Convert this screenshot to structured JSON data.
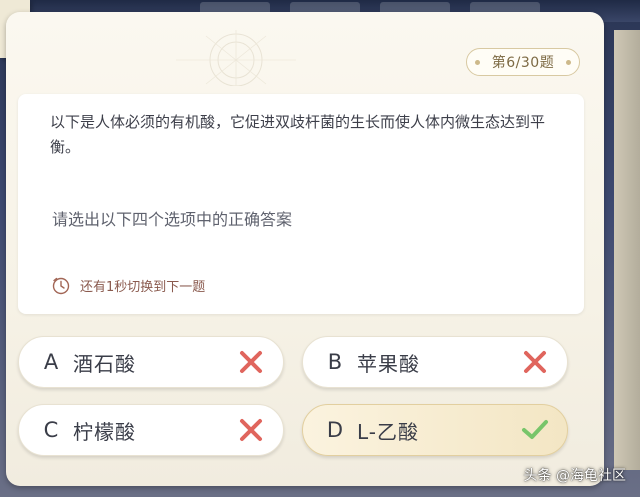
{
  "quiz": {
    "counter": "第6/30题",
    "question": "以下是人体必须的有机酸，它促进双歧杆菌的生长而使人体内微生态达到平衡。",
    "instruction": "请选出以下四个选项中的正确答案",
    "timer_text": "还有1秒切换到下一题",
    "options": [
      {
        "letter": "A",
        "text": "酒石酸",
        "status": "wrong"
      },
      {
        "letter": "B",
        "text": "苹果酸",
        "status": "wrong"
      },
      {
        "letter": "C",
        "text": "柠檬酸",
        "status": "wrong"
      },
      {
        "letter": "D",
        "text": "L-乙酸",
        "status": "correct"
      }
    ]
  },
  "watermark": "头条 @海龟社区",
  "colors": {
    "wrong_mark": "#e0655d",
    "correct_mark": "#78c56a",
    "panel_bg": "#f7f3e8",
    "counter_border": "#d8c9a2"
  },
  "icons": {
    "timer": "clock-icon",
    "wrong": "cross-icon",
    "correct": "check-icon"
  }
}
